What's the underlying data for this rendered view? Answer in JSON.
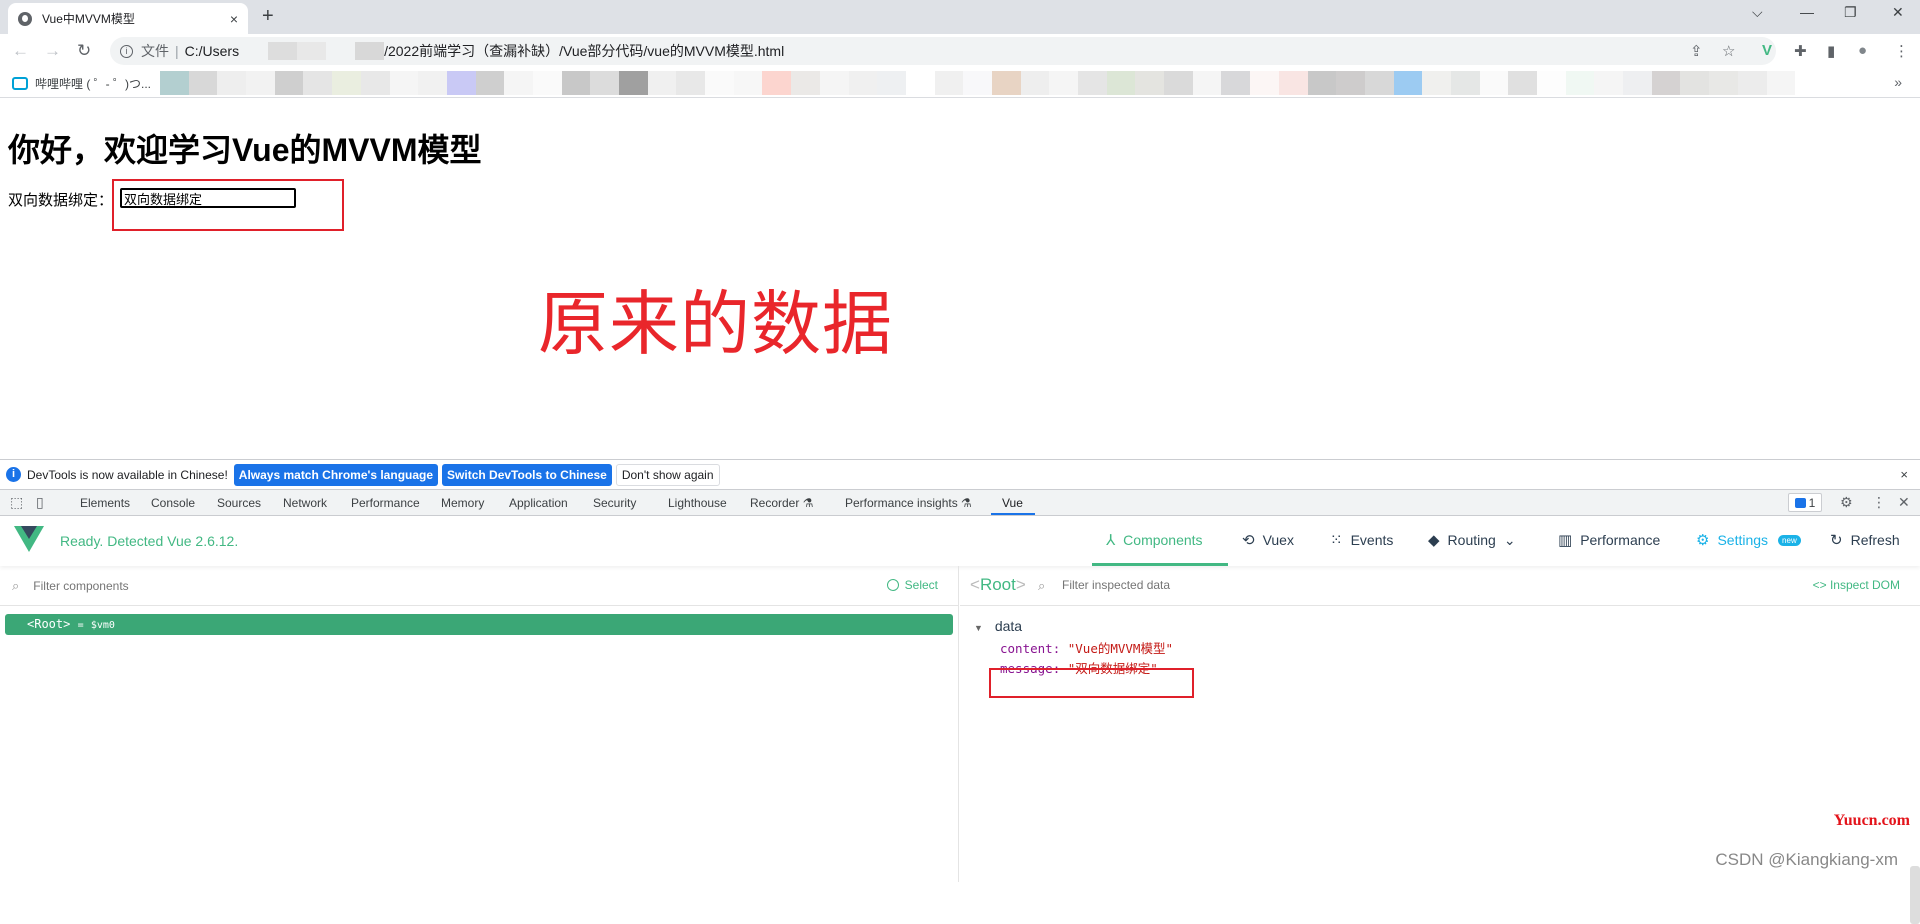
{
  "browser": {
    "tab_title": "Vue中MVVM模型",
    "tab_close": "×",
    "new_tab": "+",
    "window_controls": {
      "tab_search": "⌵",
      "minimize": "—",
      "restore": "❐",
      "close": "✕"
    },
    "nav": {
      "back": "←",
      "forward": "→",
      "reload": "↻"
    },
    "address": {
      "info": "i",
      "scheme_label": "文件",
      "separator": "|",
      "path_prefix": "C:/Users",
      "path_suffix": "/2022前端学习（查漏补缺）/Vue部分代码/vue的MVVM模型.html"
    },
    "icons": {
      "share": "⇪",
      "star": "☆",
      "vue_devtools": "V",
      "extensions": "✚",
      "side_panel": "▮",
      "profile": "●",
      "menu": "⋮"
    },
    "bookmarks": {
      "first_label": "哔哩哔哩 ( ゜- ゜)つ...",
      "more": "»",
      "blurred_colors": [
        "#b3cfd0",
        "#d8d8d8",
        "#eeeeee",
        "#f2f2f2",
        "#cfcfcf",
        "#e5e5e5",
        "#eaeee0",
        "#e8e8e8",
        "#f5f5f5",
        "#f1f1f1",
        "#c9c9f5",
        "#cfcfcf",
        "#f5f5f5",
        "#fafafa",
        "#c8c8c8",
        "#dcdcdc",
        "#a0a0a0",
        "#f0f0f0",
        "#e8e8e8",
        "#fafafa",
        "#f7f7f7",
        "#fcd5cf",
        "#ebe9e7",
        "#f5f5f5",
        "#f0f0f0",
        "#eef0f2",
        "#ffffff",
        "#f0f0f0",
        "#f8f8fa",
        "#e8d4c4",
        "#eeeeee",
        "#f5f5f5",
        "#e5e5e5",
        "#dce6d6",
        "#e4e4e0",
        "#dadada",
        "#f5f5f5",
        "#d8d8da",
        "#fcf6f5",
        "#f9e5e3",
        "#c8c8c8",
        "#cecccc",
        "#d8d8d8",
        "#9ccbf2",
        "#f0f0ee",
        "#e5e7e6",
        "#fafafa",
        "#e0e0e0",
        "#fdfdfd",
        "#f0f8f3",
        "#f5f5f5",
        "#eeeff1",
        "#d5d2d2",
        "#e3e3e1",
        "#e8e8e6",
        "#ececec",
        "#f5f5f5"
      ]
    }
  },
  "page": {
    "heading": "你好，欢迎学习Vue的MVVM模型",
    "bind_label": "双向数据绑定：",
    "bind_input_value": "双向数据绑定",
    "annotation": "原来的数据",
    "annotation_color": "#e9262b"
  },
  "devtools": {
    "infobar": {
      "icon": "i",
      "message": "DevTools is now available in Chinese!",
      "btn_match": "Always match Chrome's language",
      "btn_switch": "Switch DevTools to Chinese",
      "btn_dismiss": "Don't show again",
      "close": "×"
    },
    "tabs": [
      "Elements",
      "Console",
      "Sources",
      "Network",
      "Performance",
      "Memory",
      "Application",
      "Security",
      "Lighthouse",
      "Recorder ⚗",
      "Performance insights ⚗",
      "Vue"
    ],
    "active_tab": "Vue",
    "issues_count": "1",
    "icons": {
      "inspect": "⬚",
      "device": "▯",
      "settings": "⚙",
      "more": "⋮",
      "close": "✕"
    },
    "vue": {
      "status": "Ready. Detected Vue 2.6.12.",
      "accent": "#42b883",
      "nav": [
        {
          "icon": "⅄",
          "label": "Components"
        },
        {
          "icon": "⟲",
          "label": "Vuex"
        },
        {
          "icon": "⁙",
          "label": "Events"
        },
        {
          "icon": "◆",
          "label": "Routing",
          "caret": "⌄"
        },
        {
          "icon": "▥",
          "label": "Performance"
        },
        {
          "icon": "⚙",
          "label": "Settings",
          "badge": "new"
        },
        {
          "icon": "↻",
          "label": "Refresh"
        }
      ],
      "filter_components_placeholder": "Filter components",
      "select_label": "Select",
      "root_row": {
        "tag": "<Root>",
        "eq": "=",
        "var": "$vm0"
      },
      "inspector": {
        "title_open": "<",
        "title": "Root",
        "title_close": ">",
        "filter_placeholder": "Filter inspected data",
        "inspect_dom": "<> Inspect DOM",
        "section": "data",
        "props": [
          {
            "key": "content",
            "value": "\"Vue的MVVM模型\""
          },
          {
            "key": "message",
            "value": "\"双向数据绑定\""
          }
        ]
      }
    }
  },
  "watermarks": {
    "site": "Yuucn.com",
    "author": "CSDN @Kiangkiang-xm"
  }
}
